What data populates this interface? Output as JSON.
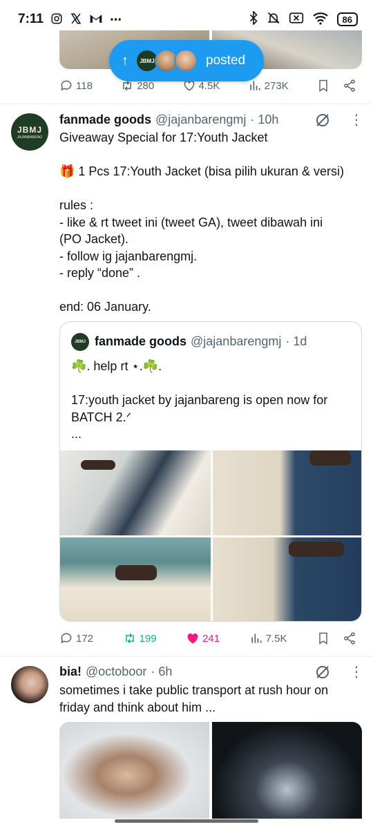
{
  "status_bar": {
    "time": "7:11",
    "left_icons": [
      "instagram-icon",
      "x-icon",
      "gmail-icon",
      "more-dots-icon"
    ],
    "right_icons": [
      "bluetooth-icon",
      "mute-icon",
      "no-sim-icon",
      "wifi-icon"
    ],
    "battery": "86"
  },
  "posted_pill": {
    "label": "posted",
    "avatar_text": "JBMJ"
  },
  "top_tweet_actions": {
    "replies": "118",
    "reposts": "280",
    "likes": "4.5K",
    "views": "273K"
  },
  "tweet1": {
    "avatar_text": "JBMJ",
    "avatar_subtext": "JAJANBARENG",
    "name": "fanmade goods",
    "handle": "@jajanbarengmj",
    "time": "· 10h",
    "lines": [
      "Giveaway Special for 17:Youth Jacket",
      "",
      "🎁 1 Pcs 17:Youth Jacket (bisa pilih ukuran & versi)",
      "",
      "rules :",
      "- like & rt tweet ini (tweet GA), tweet dibawah ini",
      "(PO Jacket).",
      "- follow ig jajanbarengmj.",
      "- reply “done” .",
      "",
      "end: 06 January."
    ],
    "quote": {
      "avatar_text": "JBMJ",
      "name": "fanmade goods",
      "handle": "@jajanbarengmj",
      "time": "· 1d",
      "lines": [
        "☘️. help rt ⋆.☘️.",
        "",
        "17:youth jacket by jajanbareng is open now for",
        "BATCH 2.ᐟ",
        "..."
      ]
    },
    "actions": {
      "replies": "172",
      "reposts": "199",
      "likes": "241",
      "views": "7.5K"
    }
  },
  "tweet2": {
    "name": "bia!",
    "handle": "@octoboor",
    "time": "· 6h",
    "lines": [
      "sometimes i take public transport at rush hour on",
      "friday and think about him ..."
    ]
  },
  "colors": {
    "accent": "#1d9bf0",
    "repost_green": "#00ba7c",
    "like_pink": "#f91880",
    "muted": "#536471"
  }
}
